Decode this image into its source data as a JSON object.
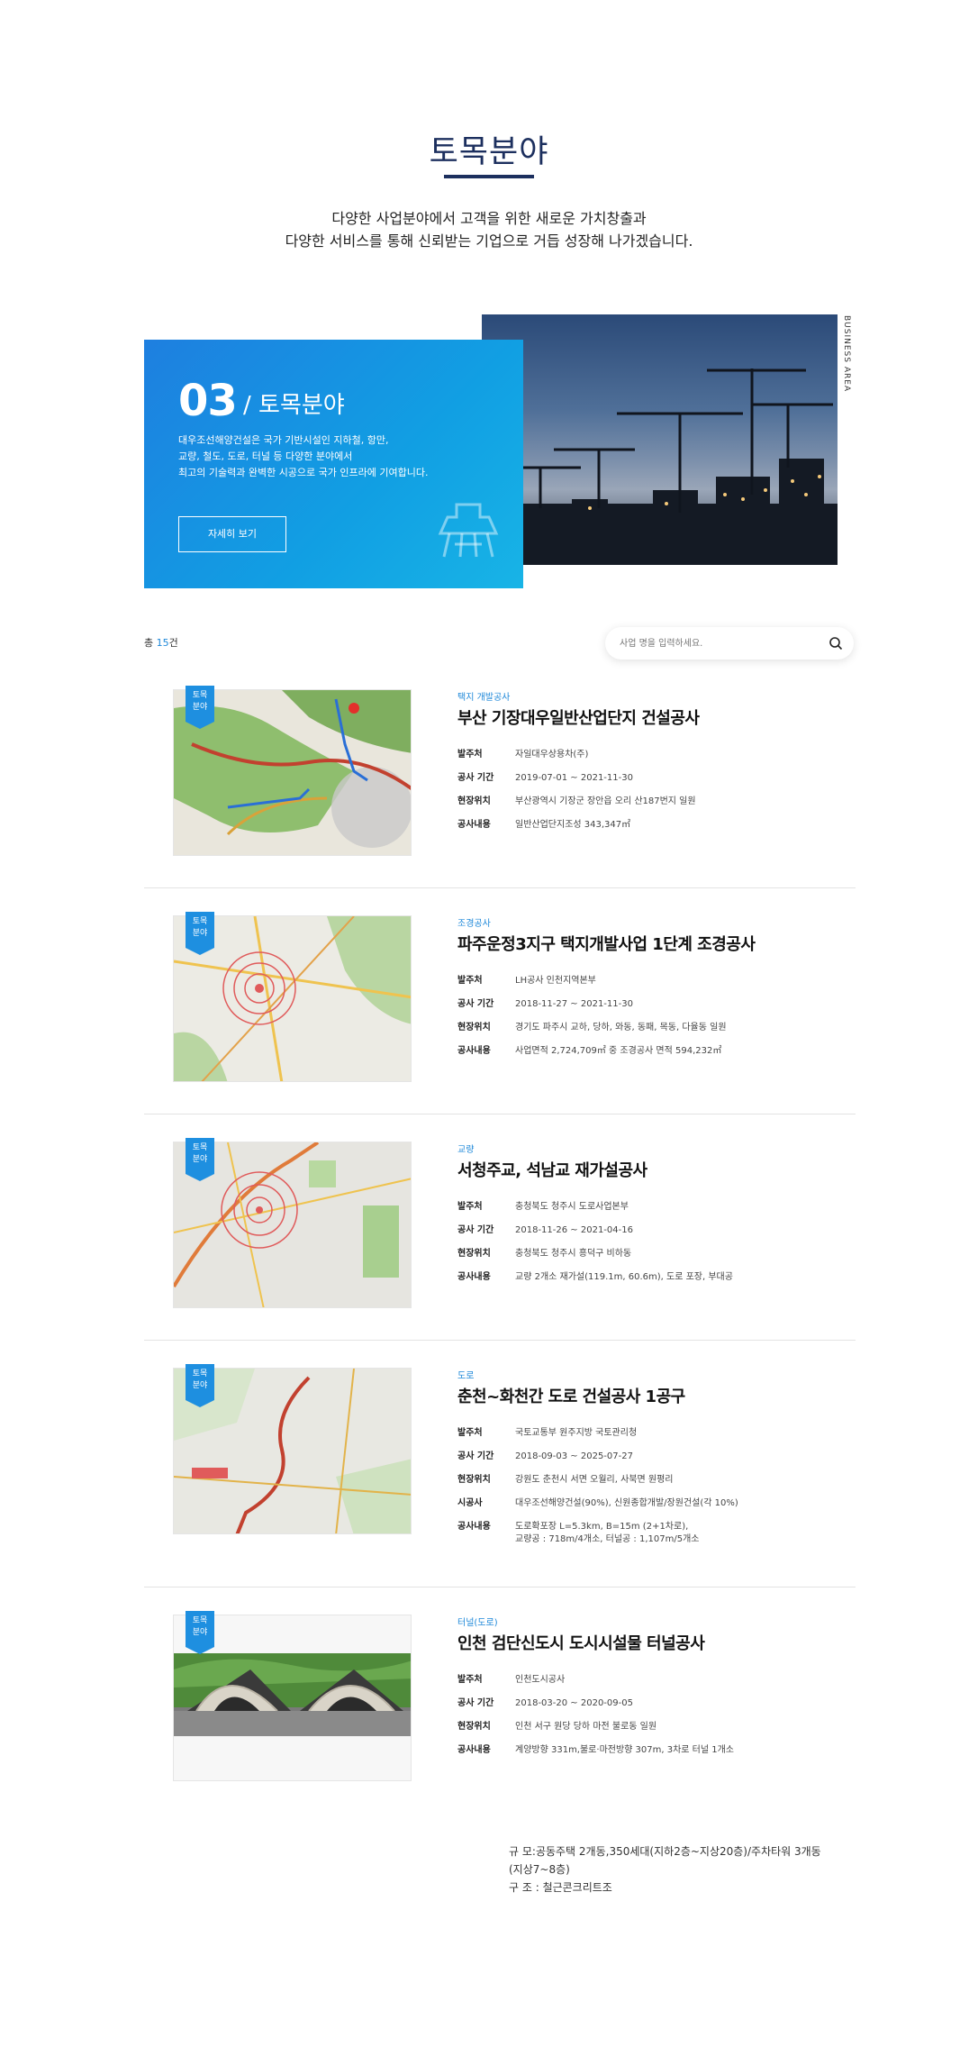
{
  "header": {
    "title": "토목분야",
    "intro_line1": "다양한 사업분야에서 고객을 위한 새로운 가치창출과",
    "intro_line2": "다양한 서비스를 통해 신뢰받는 기업으로 거듭 성장해 나가겠습니다."
  },
  "hero": {
    "number": "03",
    "subtitle": "/ 토목분야",
    "desc_line1": "대우조선해양건설은 국가 기반시설인 지하철, 항만,",
    "desc_line2": "교량, 철도, 도로, 터널 등 다양한 분야에서",
    "desc_line3": "최고의 기술력과 완벽한 시공으로 국가 인프라에 기여합니다.",
    "button_label": "자세히 보기",
    "side_label": "BUSINESS AREA"
  },
  "listing": {
    "total_prefix": "총 ",
    "total_count": "15",
    "total_suffix": "건",
    "search_placeholder": "사업 명을 입력하세요."
  },
  "projects": [
    {
      "tag": "토목\n분야",
      "category": "택지 개발공사",
      "title": "부산 기장대우일반산업단지 건설공사",
      "rows": [
        {
          "k": "발주처",
          "v": "자일대우상용차(주)"
        },
        {
          "k": "공사 기간",
          "v": "2019-07-01 ~ 2021-11-30"
        },
        {
          "k": "현장위치",
          "v": "부산광역시 기장군 장안읍 오리 산187번지 일원"
        },
        {
          "k": "공사내용",
          "v": "일반산업단지조성 343,347㎡"
        }
      ]
    },
    {
      "tag": "토목\n분야",
      "category": "조경공사",
      "title": "파주운정3지구 택지개발사업 1단계 조경공사",
      "rows": [
        {
          "k": "발주처",
          "v": "LH공사 인천지역본부"
        },
        {
          "k": "공사 기간",
          "v": "2018-11-27 ~ 2021-11-30"
        },
        {
          "k": "현장위치",
          "v": "경기도 파주시 교하, 당하, 와동, 동패, 목동, 다율동 일원"
        },
        {
          "k": "공사내용",
          "v": "사업면적 2,724,709㎡ 중 조경공사 면적 594,232㎡"
        }
      ]
    },
    {
      "tag": "토목\n분야",
      "category": "교량",
      "title": "서청주교, 석남교 재가설공사",
      "rows": [
        {
          "k": "발주처",
          "v": "충청북도 청주시 도로사업본부"
        },
        {
          "k": "공사 기간",
          "v": "2018-11-26 ~ 2021-04-16"
        },
        {
          "k": "현장위치",
          "v": "충청북도 청주시 흥덕구 비하동"
        },
        {
          "k": "공사내용",
          "v": "교량 2개소 재가설(119.1m, 60.6m), 도로 포장, 부대공"
        }
      ]
    },
    {
      "tag": "토목\n분야",
      "category": "도로",
      "title": "춘천~화천간 도로 건설공사 1공구",
      "rows": [
        {
          "k": "발주처",
          "v": "국토교통부 원주지방 국토관리청"
        },
        {
          "k": "공사 기간",
          "v": "2018-09-03 ~ 2025-07-27"
        },
        {
          "k": "현장위치",
          "v": "강원도 춘천시 서면 오월리, 사북면 원평리"
        },
        {
          "k": "시공사",
          "v": "대우조선해양건설(90%), 신원종합개발/장원건설(각 10%)"
        },
        {
          "k": "공사내용",
          "v": "도로확포장 L=5.3km, B=15m (2+1차로),\n교량공 : 718m/4개소, 터널공 : 1,107m/5개소"
        }
      ]
    },
    {
      "tag": "토목\n분야",
      "category": "터널(도로)",
      "title": "인천 검단신도시 도시시설물 터널공사",
      "rows": [
        {
          "k": "발주처",
          "v": "인천도시공사"
        },
        {
          "k": "공사 기간",
          "v": "2018-03-20 ~ 2020-09-05"
        },
        {
          "k": "현장위치",
          "v": "인천 서구 원당 당하 마전 불로동 일원"
        },
        {
          "k": "공사내용",
          "v": "계양방향 331m,불로·마전방향 307m, 3차로 터널 1개소"
        }
      ]
    }
  ],
  "footnote": "규 모:공동주택 2개동,350세대(지하2층~지상20층)/주차타워 3개동\n(지상7~8층)\n구 조 : 철근콘크리트조"
}
